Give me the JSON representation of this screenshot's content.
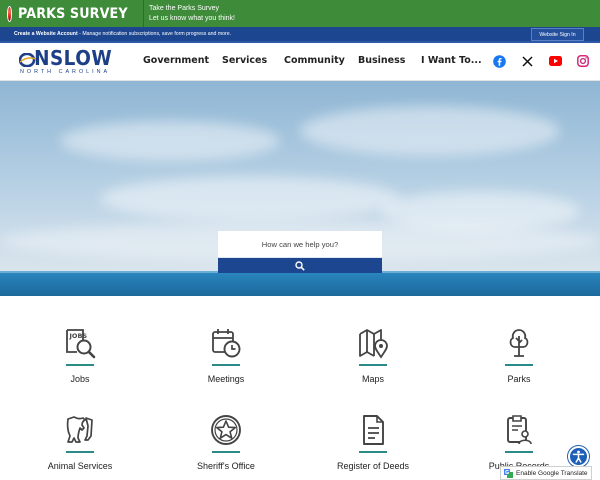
{
  "banner": {
    "title": "PARKS SURVEY",
    "line1": "Take the Parks Survey",
    "line2": "Let us know what you think!"
  },
  "account_bar": {
    "link": "Create a Website Account",
    "text": " - Manage notification subscriptions, save form progress and more.",
    "signin": "Website Sign In"
  },
  "logo": {
    "name": "NSLOW",
    "name_full": "ONSLOW",
    "subtitle": "NORTH CAROLINA"
  },
  "nav": {
    "items": [
      "Government",
      "Services",
      "Community",
      "Business",
      "I Want To..."
    ]
  },
  "social": {
    "icons": [
      "facebook-icon",
      "x-icon",
      "youtube-icon",
      "instagram-icon"
    ]
  },
  "search": {
    "placeholder": "How can we help you?"
  },
  "quick_links": [
    {
      "label": "Jobs",
      "icon": "jobs-icon"
    },
    {
      "label": "Meetings",
      "icon": "calendar-clock-icon"
    },
    {
      "label": "Maps",
      "icon": "map-pin-icon"
    },
    {
      "label": "Parks",
      "icon": "tree-icon"
    },
    {
      "label": "Animal Services",
      "icon": "animal-icon"
    },
    {
      "label": "Sheriff's Office",
      "icon": "sheriff-badge-icon"
    },
    {
      "label": "Register of Deeds",
      "icon": "document-icon"
    },
    {
      "label": "Public Records",
      "icon": "records-icon"
    }
  ],
  "widgets": {
    "translate": "Enable Google Translate"
  },
  "colors": {
    "banner_green": "#3e8b3a",
    "brand_blue": "#1d4690",
    "accent_teal": "#2a8a85"
  }
}
